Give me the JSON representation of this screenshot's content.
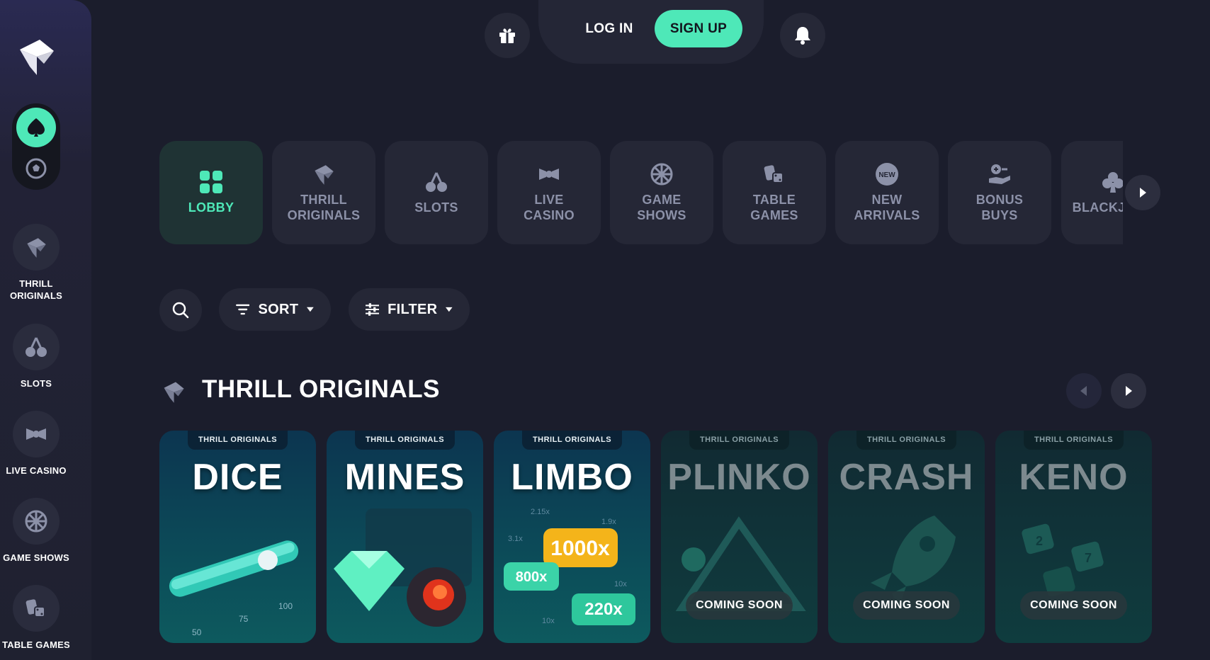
{
  "topbar": {
    "login_label": "LOG IN",
    "signup_label": "SIGN UP"
  },
  "sidebar": {
    "items": [
      {
        "label": "THRILL\nORIGINALS",
        "icon": "thrill-logo-icon"
      },
      {
        "label": "SLOTS",
        "icon": "cherries-icon"
      },
      {
        "label": "LIVE CASINO",
        "icon": "live-casino-icon"
      },
      {
        "label": "GAME SHOWS",
        "icon": "wheel-icon"
      },
      {
        "label": "TABLE GAMES",
        "icon": "cards-dice-icon"
      }
    ]
  },
  "categories": [
    {
      "label": "LOBBY",
      "icon": "grid-icon"
    },
    {
      "label": "THRILL\nORIGINALS",
      "icon": "thrill-logo-icon"
    },
    {
      "label": "SLOTS",
      "icon": "cherries-icon"
    },
    {
      "label": "LIVE\nCASINO",
      "icon": "live-casino-icon"
    },
    {
      "label": "GAME\nSHOWS",
      "icon": "wheel-icon"
    },
    {
      "label": "TABLE\nGAMES",
      "icon": "cards-dice-icon"
    },
    {
      "label": "NEW\nARRIVALS",
      "icon": "new-badge-icon"
    },
    {
      "label": "BONUS\nBUYS",
      "icon": "bonus-hand-icon"
    },
    {
      "label": "BLACKJACK",
      "icon": "club-icon"
    }
  ],
  "new_badge_text": "NEW",
  "toolbar": {
    "sort_label": "SORT",
    "filter_label": "FILTER"
  },
  "section": {
    "title": "THRILL ORIGINALS"
  },
  "games": [
    {
      "tag": "THRILL ORIGINALS",
      "title": "DICE",
      "status": ""
    },
    {
      "tag": "THRILL ORIGINALS",
      "title": "MINES",
      "status": ""
    },
    {
      "tag": "THRILL ORIGINALS",
      "title": "LIMBO",
      "status": ""
    },
    {
      "tag": "THRILL ORIGINALS",
      "title": "PLINKO",
      "status": "COMING SOON"
    },
    {
      "tag": "THRILL ORIGINALS",
      "title": "CRASH",
      "status": "COMING SOON"
    },
    {
      "tag": "THRILL ORIGINALS",
      "title": "KENO",
      "status": "COMING SOON"
    }
  ],
  "art_text": {
    "dice_scale": [
      "50",
      "75",
      "100"
    ],
    "limbo_multipliers": [
      "1000x",
      "800x",
      "220x",
      "2.15x",
      "1.9x",
      "3.1x",
      "10x",
      "10x"
    ],
    "keno_tiles": [
      "2",
      "7"
    ]
  },
  "colors": {
    "accent": "#4ee8b8",
    "background": "#1b1d2c",
    "panel": "#252736",
    "muted_text": "#8c91a8"
  }
}
